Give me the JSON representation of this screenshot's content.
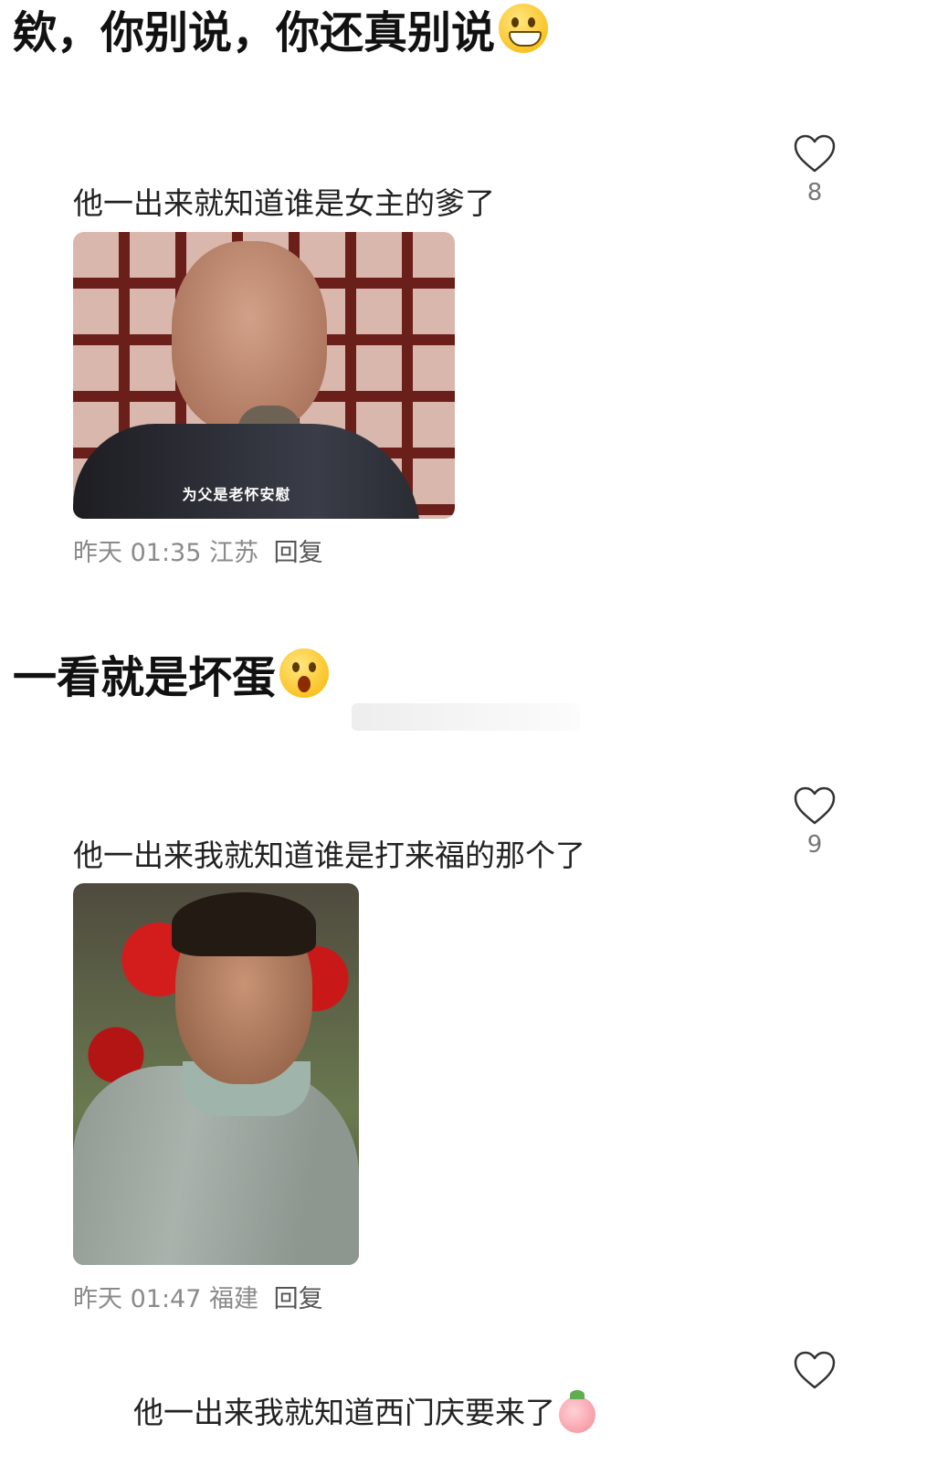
{
  "headings": {
    "first": "欸，你别说，你还真别说",
    "second": "一看就是坏蛋"
  },
  "comments": [
    {
      "text": "他一出来就知道谁是女主的爹了",
      "likes": "8",
      "image_caption": "为父是老怀安慰",
      "time": "昨天 01:35",
      "location": "江苏",
      "reply": "回复"
    },
    {
      "text": "他一出来我就知道谁是打来福的那个了",
      "likes": "9",
      "time": "昨天 01:47",
      "location": "福建",
      "reply": "回复"
    },
    {
      "text": "他一出来我就知道西门庆要来了"
    }
  ],
  "icons": {
    "like": "heart-outline-icon",
    "emoji_grin": "grinning-emoji-icon",
    "emoji_shock": "astonished-emoji-icon",
    "emoji_peach": "peach-emoji-icon"
  },
  "colors": {
    "text_primary": "#222222",
    "text_meta": "#8a8a8a",
    "background": "#ffffff"
  }
}
